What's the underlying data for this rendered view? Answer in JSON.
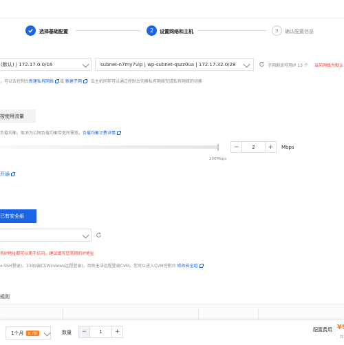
{
  "steps": [
    {
      "label": "选择基础配置"
    },
    {
      "number": "2",
      "label": "设置网络和主机"
    },
    {
      "number": "3",
      "label": "确认配置信息"
    }
  ],
  "network": {
    "vpc_value": "(默认) | 172.17.0.0/16",
    "subnet_value": "subnet-n7my7vip | wp-subnet-qszz0ua | 172.17.32.0/28",
    "subnet_hint": "子网剩余可用IP 13 个",
    "current_network_hint": "当前网络为默认",
    "desc_text": "，可以去控制台",
    "new_vpc_link": "新建私有网络",
    "or_text": "或",
    "new_subnet_link": "新建子网",
    "desc_tail": "，云主机同样可以通过控制台切换私有网络完成私有网络的切换"
  },
  "bandwidth": {
    "mode_button": "按使用流量",
    "desc_text": "负载均衡，取消为公网负载均衡带宽所需宽。",
    "lb_link": "负载均衡计费详情",
    "slider_max_label": "200Mbps",
    "value": "2",
    "unit": "Mbps",
    "minus": "−",
    "plus": "+"
  },
  "ipv6": {
    "open_link": "开通"
  },
  "security": {
    "existing_button": "已有安全组",
    "warning": "有IP地址都可以用于访问，建议填写您常用的IP地址",
    "ports_text": "x SSH登录)，3389端口(Windows远程登录)，否则无法远程登录CVM。您可以进入CVM控制台",
    "edit_link": "修改安全组",
    "rules_label": "规则"
  },
  "footer": {
    "duration": "1个月",
    "discount_badge": "8.7折",
    "quantity_label": "数量",
    "quantity_value": "1",
    "minus": "−",
    "plus": "+",
    "fee_label": "配置费用",
    "price_prefix": "¥9",
    "price_sub": "共"
  },
  "colors": {
    "primary": "#1a64e8",
    "warning": "#e64340",
    "badge": "#ff7a1a"
  }
}
